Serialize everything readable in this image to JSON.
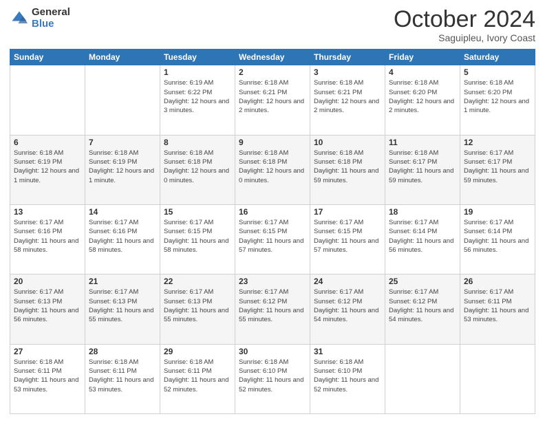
{
  "logo": {
    "general": "General",
    "blue": "Blue"
  },
  "header": {
    "month": "October 2024",
    "location": "Saguipleu, Ivory Coast"
  },
  "weekdays": [
    "Sunday",
    "Monday",
    "Tuesday",
    "Wednesday",
    "Thursday",
    "Friday",
    "Saturday"
  ],
  "weeks": [
    [
      {
        "day": "",
        "info": ""
      },
      {
        "day": "",
        "info": ""
      },
      {
        "day": "1",
        "info": "Sunrise: 6:19 AM\nSunset: 6:22 PM\nDaylight: 12 hours and 3 minutes."
      },
      {
        "day": "2",
        "info": "Sunrise: 6:18 AM\nSunset: 6:21 PM\nDaylight: 12 hours and 2 minutes."
      },
      {
        "day": "3",
        "info": "Sunrise: 6:18 AM\nSunset: 6:21 PM\nDaylight: 12 hours and 2 minutes."
      },
      {
        "day": "4",
        "info": "Sunrise: 6:18 AM\nSunset: 6:20 PM\nDaylight: 12 hours and 2 minutes."
      },
      {
        "day": "5",
        "info": "Sunrise: 6:18 AM\nSunset: 6:20 PM\nDaylight: 12 hours and 1 minute."
      }
    ],
    [
      {
        "day": "6",
        "info": "Sunrise: 6:18 AM\nSunset: 6:19 PM\nDaylight: 12 hours and 1 minute."
      },
      {
        "day": "7",
        "info": "Sunrise: 6:18 AM\nSunset: 6:19 PM\nDaylight: 12 hours and 1 minute."
      },
      {
        "day": "8",
        "info": "Sunrise: 6:18 AM\nSunset: 6:18 PM\nDaylight: 12 hours and 0 minutes."
      },
      {
        "day": "9",
        "info": "Sunrise: 6:18 AM\nSunset: 6:18 PM\nDaylight: 12 hours and 0 minutes."
      },
      {
        "day": "10",
        "info": "Sunrise: 6:18 AM\nSunset: 6:18 PM\nDaylight: 11 hours and 59 minutes."
      },
      {
        "day": "11",
        "info": "Sunrise: 6:18 AM\nSunset: 6:17 PM\nDaylight: 11 hours and 59 minutes."
      },
      {
        "day": "12",
        "info": "Sunrise: 6:17 AM\nSunset: 6:17 PM\nDaylight: 11 hours and 59 minutes."
      }
    ],
    [
      {
        "day": "13",
        "info": "Sunrise: 6:17 AM\nSunset: 6:16 PM\nDaylight: 11 hours and 58 minutes."
      },
      {
        "day": "14",
        "info": "Sunrise: 6:17 AM\nSunset: 6:16 PM\nDaylight: 11 hours and 58 minutes."
      },
      {
        "day": "15",
        "info": "Sunrise: 6:17 AM\nSunset: 6:15 PM\nDaylight: 11 hours and 58 minutes."
      },
      {
        "day": "16",
        "info": "Sunrise: 6:17 AM\nSunset: 6:15 PM\nDaylight: 11 hours and 57 minutes."
      },
      {
        "day": "17",
        "info": "Sunrise: 6:17 AM\nSunset: 6:15 PM\nDaylight: 11 hours and 57 minutes."
      },
      {
        "day": "18",
        "info": "Sunrise: 6:17 AM\nSunset: 6:14 PM\nDaylight: 11 hours and 56 minutes."
      },
      {
        "day": "19",
        "info": "Sunrise: 6:17 AM\nSunset: 6:14 PM\nDaylight: 11 hours and 56 minutes."
      }
    ],
    [
      {
        "day": "20",
        "info": "Sunrise: 6:17 AM\nSunset: 6:13 PM\nDaylight: 11 hours and 56 minutes."
      },
      {
        "day": "21",
        "info": "Sunrise: 6:17 AM\nSunset: 6:13 PM\nDaylight: 11 hours and 55 minutes."
      },
      {
        "day": "22",
        "info": "Sunrise: 6:17 AM\nSunset: 6:13 PM\nDaylight: 11 hours and 55 minutes."
      },
      {
        "day": "23",
        "info": "Sunrise: 6:17 AM\nSunset: 6:12 PM\nDaylight: 11 hours and 55 minutes."
      },
      {
        "day": "24",
        "info": "Sunrise: 6:17 AM\nSunset: 6:12 PM\nDaylight: 11 hours and 54 minutes."
      },
      {
        "day": "25",
        "info": "Sunrise: 6:17 AM\nSunset: 6:12 PM\nDaylight: 11 hours and 54 minutes."
      },
      {
        "day": "26",
        "info": "Sunrise: 6:17 AM\nSunset: 6:11 PM\nDaylight: 11 hours and 53 minutes."
      }
    ],
    [
      {
        "day": "27",
        "info": "Sunrise: 6:18 AM\nSunset: 6:11 PM\nDaylight: 11 hours and 53 minutes."
      },
      {
        "day": "28",
        "info": "Sunrise: 6:18 AM\nSunset: 6:11 PM\nDaylight: 11 hours and 53 minutes."
      },
      {
        "day": "29",
        "info": "Sunrise: 6:18 AM\nSunset: 6:11 PM\nDaylight: 11 hours and 52 minutes."
      },
      {
        "day": "30",
        "info": "Sunrise: 6:18 AM\nSunset: 6:10 PM\nDaylight: 11 hours and 52 minutes."
      },
      {
        "day": "31",
        "info": "Sunrise: 6:18 AM\nSunset: 6:10 PM\nDaylight: 11 hours and 52 minutes."
      },
      {
        "day": "",
        "info": ""
      },
      {
        "day": "",
        "info": ""
      }
    ]
  ]
}
